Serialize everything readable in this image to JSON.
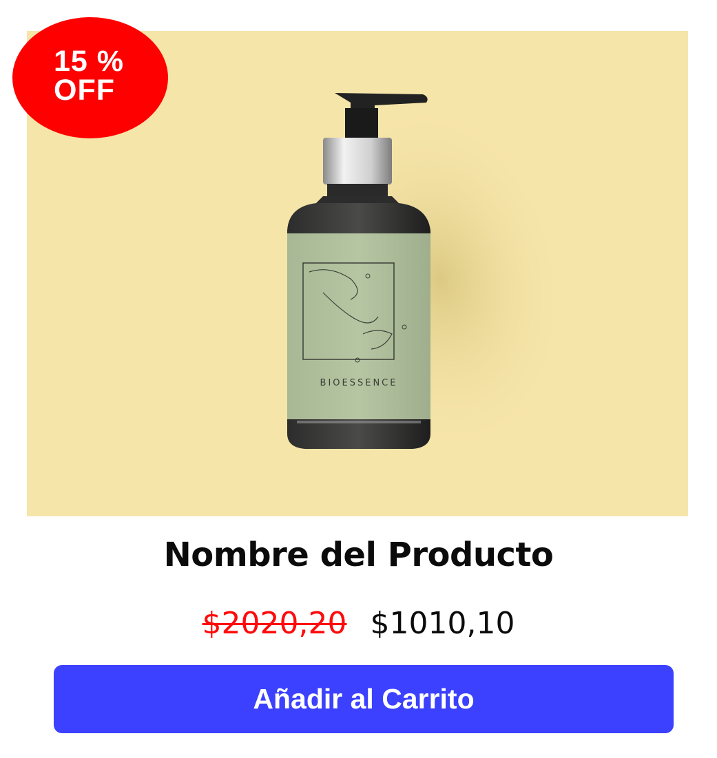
{
  "product": {
    "title": "Nombre del Producto",
    "image_alt": "BIOESSENCE",
    "label_brand": "BIOESSENCE",
    "discount": {
      "line1": "15 %",
      "line2": "OFF"
    },
    "price_original": "$2020,20",
    "price_sale": "$1010,10"
  },
  "actions": {
    "add_to_cart_label": "Añadir al Carrito"
  },
  "colors": {
    "image_background": "#f6e5a9",
    "badge": "#fe0000",
    "button": "#3b41fe",
    "old_price": "#ff0a0a",
    "label": "#b2c4a0"
  }
}
